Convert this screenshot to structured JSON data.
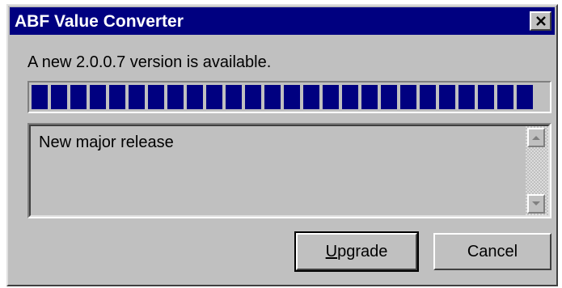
{
  "window": {
    "title": "ABF Value Converter",
    "close_icon": "close-icon"
  },
  "message": "A new 2.0.0.7 version is available.",
  "progress": {
    "percent": 100,
    "color": "#000080"
  },
  "release_notes": {
    "text": "New major release",
    "scroll_up_icon": "arrow-up-icon",
    "scroll_down_icon": "arrow-down-icon"
  },
  "buttons": {
    "upgrade_mnemonic": "U",
    "upgrade_rest": "pgrade",
    "cancel": "Cancel"
  },
  "colors": {
    "titlebar": "#000080",
    "dialog_bg": "#c0c0c0"
  }
}
